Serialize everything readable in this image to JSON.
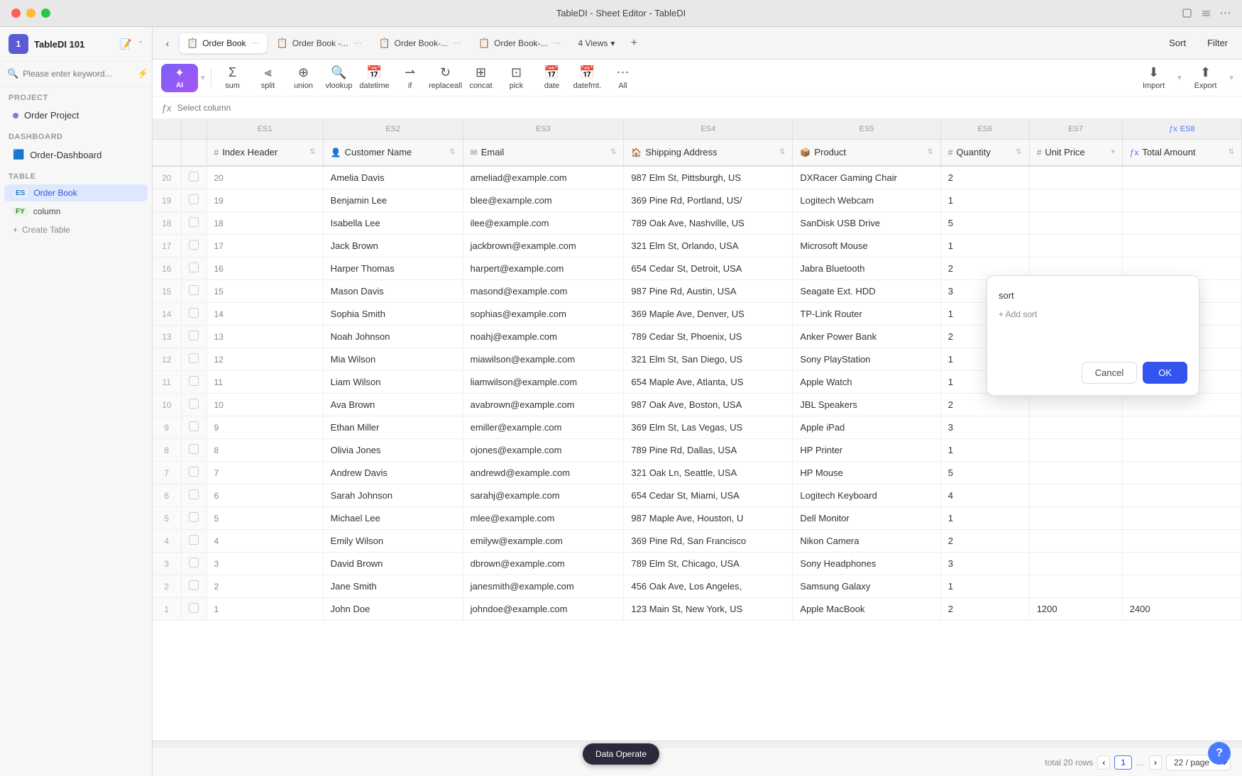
{
  "titleBar": {
    "title": "TableDI - Sheet Editor - TableDI",
    "buttons": [
      "close",
      "minimize",
      "maximize"
    ]
  },
  "sidebar": {
    "appName": "TableDI 101",
    "appIcon": "1",
    "searchPlaceholder": "Please enter keyword...",
    "projectLabel": "Project",
    "projectItem": "Order Project",
    "dashboardLabel": "Dashboard",
    "dashboardItem": "Order-Dashboard",
    "tableLabel": "Table",
    "tables": [
      {
        "tag": "ES",
        "name": "Order Book",
        "active": true
      },
      {
        "tag": "FY",
        "name": "column",
        "active": false
      }
    ],
    "createTable": "Create Table"
  },
  "tabs": [
    {
      "icon": "📋",
      "label": "Order Book",
      "active": true
    },
    {
      "icon": "📋",
      "label": "Order Book -...",
      "active": false
    },
    {
      "icon": "📋",
      "label": "Order Book-...",
      "active": false
    },
    {
      "icon": "📋",
      "label": "Order Book-...",
      "active": false
    }
  ],
  "viewsBtn": "4 Views",
  "sortBtn": "Sort",
  "filterBtn": "Filter",
  "toolbar": {
    "ai": "AI",
    "sum": "sum",
    "split": "split",
    "union": "union",
    "vlookup": "vlookup",
    "datetime": "datetime",
    "if": "if",
    "replaceall": "replaceall",
    "concat": "concat",
    "pick": "pick",
    "date": "date",
    "datefmt": "datefmt.",
    "all": "All",
    "import": "Import",
    "export": "Export"
  },
  "formulaBar": {
    "fx": "ƒx",
    "placeholder": "Select column"
  },
  "columns": {
    "es": [
      "ES1",
      "ES2",
      "ES3",
      "ES4",
      "ES5",
      "ES6",
      "ES7",
      "ES8"
    ],
    "headers": [
      {
        "id": "index",
        "icon": "#",
        "label": "Index Header",
        "field": "index"
      },
      {
        "id": "customer",
        "icon": "👤",
        "label": "Customer Name",
        "field": "customer"
      },
      {
        "id": "email",
        "icon": "✉",
        "label": "Email",
        "field": "email"
      },
      {
        "id": "address",
        "icon": "🏠",
        "label": "Shipping Address",
        "field": "address"
      },
      {
        "id": "product",
        "icon": "📦",
        "label": "Product",
        "field": "product"
      },
      {
        "id": "quantity",
        "icon": "#",
        "label": "Quantity",
        "field": "quantity"
      },
      {
        "id": "unitprice",
        "icon": "#",
        "label": "Unit Price",
        "field": "unitprice"
      },
      {
        "id": "total",
        "icon": "ƒx",
        "label": "Total Amount",
        "field": "total"
      }
    ]
  },
  "rows": [
    {
      "index": "20",
      "customer": "Amelia Davis",
      "email": "ameliad@example.com",
      "address": "987 Elm St, Pittsburgh, US",
      "product": "DXRacer Gaming Chair",
      "quantity": "2",
      "unitprice": "",
      "total": ""
    },
    {
      "index": "19",
      "customer": "Benjamin Lee",
      "email": "blee@example.com",
      "address": "369 Pine Rd, Portland, US/",
      "product": "Logitech Webcam",
      "quantity": "1",
      "unitprice": "",
      "total": ""
    },
    {
      "index": "18",
      "customer": "Isabella Lee",
      "email": "ilee@example.com",
      "address": "789 Oak Ave, Nashville, US",
      "product": "SanDisk USB Drive",
      "quantity": "5",
      "unitprice": "",
      "total": ""
    },
    {
      "index": "17",
      "customer": "Jack Brown",
      "email": "jackbrown@example.com",
      "address": "321 Elm St, Orlando, USA",
      "product": "Microsoft Mouse",
      "quantity": "1",
      "unitprice": "",
      "total": ""
    },
    {
      "index": "16",
      "customer": "Harper Thomas",
      "email": "harpert@example.com",
      "address": "654 Cedar St, Detroit, USA",
      "product": "Jabra Bluetooth",
      "quantity": "2",
      "unitprice": "",
      "total": ""
    },
    {
      "index": "15",
      "customer": "Mason Davis",
      "email": "masond@example.com",
      "address": "987 Pine Rd, Austin, USA",
      "product": "Seagate Ext. HDD",
      "quantity": "3",
      "unitprice": "",
      "total": ""
    },
    {
      "index": "14",
      "customer": "Sophia Smith",
      "email": "sophias@example.com",
      "address": "369 Maple Ave, Denver, US",
      "product": "TP-Link Router",
      "quantity": "1",
      "unitprice": "",
      "total": ""
    },
    {
      "index": "13",
      "customer": "Noah Johnson",
      "email": "noahj@example.com",
      "address": "789 Cedar St, Phoenix, US",
      "product": "Anker Power Bank",
      "quantity": "2",
      "unitprice": "",
      "total": ""
    },
    {
      "index": "12",
      "customer": "Mia Wilson",
      "email": "miawilson@example.com",
      "address": "321 Elm St, San Diego, US",
      "product": "Sony PlayStation",
      "quantity": "1",
      "unitprice": "",
      "total": ""
    },
    {
      "index": "11",
      "customer": "Liam Wilson",
      "email": "liamwilson@example.com",
      "address": "654 Maple Ave, Atlanta, US",
      "product": "Apple Watch",
      "quantity": "1",
      "unitprice": "",
      "total": ""
    },
    {
      "index": "10",
      "customer": "Ava Brown",
      "email": "avabrown@example.com",
      "address": "987 Oak Ave, Boston, USA",
      "product": "JBL Speakers",
      "quantity": "2",
      "unitprice": "",
      "total": ""
    },
    {
      "index": "9",
      "customer": "Ethan Miller",
      "email": "emiller@example.com",
      "address": "369 Elm St, Las Vegas, US",
      "product": "Apple iPad",
      "quantity": "3",
      "unitprice": "",
      "total": ""
    },
    {
      "index": "8",
      "customer": "Olivia Jones",
      "email": "ojones@example.com",
      "address": "789 Pine Rd, Dallas, USA",
      "product": "HP Printer",
      "quantity": "1",
      "unitprice": "",
      "total": ""
    },
    {
      "index": "7",
      "customer": "Andrew Davis",
      "email": "andrewd@example.com",
      "address": "321 Oak Ln, Seattle, USA",
      "product": "HP Mouse",
      "quantity": "5",
      "unitprice": "",
      "total": ""
    },
    {
      "index": "6",
      "customer": "Sarah Johnson",
      "email": "sarahj@example.com",
      "address": "654 Cedar St, Miami, USA",
      "product": "Logitech Keyboard",
      "quantity": "4",
      "unitprice": "",
      "total": ""
    },
    {
      "index": "5",
      "customer": "Michael Lee",
      "email": "mlee@example.com",
      "address": "987 Maple Ave, Houston, U",
      "product": "Dell Monitor",
      "quantity": "1",
      "unitprice": "",
      "total": ""
    },
    {
      "index": "4",
      "customer": "Emily Wilson",
      "email": "emilyw@example.com",
      "address": "369 Pine Rd, San Francisco",
      "product": "Nikon Camera",
      "quantity": "2",
      "unitprice": "",
      "total": ""
    },
    {
      "index": "3",
      "customer": "David Brown",
      "email": "dbrown@example.com",
      "address": "789 Elm St, Chicago, USA",
      "product": "Sony Headphones",
      "quantity": "3",
      "unitprice": "",
      "total": ""
    },
    {
      "index": "2",
      "customer": "Jane Smith",
      "email": "janesmith@example.com",
      "address": "456 Oak Ave, Los Angeles,",
      "product": "Samsung Galaxy",
      "quantity": "1",
      "unitprice": "",
      "total": ""
    },
    {
      "index": "1",
      "customer": "John Doe",
      "email": "johndoe@example.com",
      "address": "123 Main St, New York, US",
      "product": "Apple MacBook",
      "quantity": "2",
      "unitprice": "1200",
      "total": "2400"
    }
  ],
  "sortOverlay": {
    "label": "sort",
    "addSort": "+ Add sort",
    "cancel": "Cancel",
    "ok": "OK"
  },
  "statusBar": {
    "totalRows": "total 20 rows",
    "currentPage": "1",
    "pageSize": "22 / page"
  },
  "dataOperateBtn": "Data Operate",
  "helpBtn": "?"
}
